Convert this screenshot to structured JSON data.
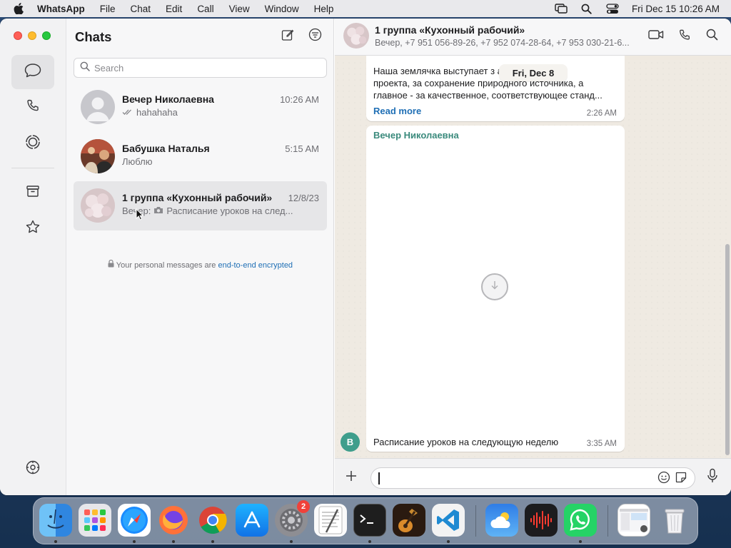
{
  "menubar": {
    "app_name": "WhatsApp",
    "items": [
      "File",
      "Chat",
      "Edit",
      "Call",
      "View",
      "Window",
      "Help"
    ],
    "clock": "Fri Dec 15  10:26 AM"
  },
  "sidebar": {
    "icons": [
      "chats-icon",
      "calls-icon",
      "status-icon",
      "archive-icon",
      "starred-icon",
      "settings-icon"
    ]
  },
  "chatlist": {
    "title": "Chats",
    "search_placeholder": "Search",
    "chats": [
      {
        "name": "Вечер Николаевна",
        "time": "10:26 AM",
        "preview": "hahahaha"
      },
      {
        "name": "Бабушка Наталья",
        "time": "5:15 AM",
        "preview": "Люблю"
      },
      {
        "name": "1 группа «Кухонный рабочий»",
        "time": "12/8/23",
        "preview_sender": "Вечер:",
        "preview": "Расписание уроков на след..."
      }
    ],
    "encrypted_prefix": "Your personal messages are",
    "encrypted_link": "end-to-end encrypted"
  },
  "conversation": {
    "title": "1 группа «Кухонный рабочий»",
    "subtitle": "Вечер, +7 951 056-89-26, +7 952 074-28-64, +7 953 030-21-6...",
    "date_pill": "Fri, Dec 8",
    "message1": {
      "lines": [
        "Наша землячка выступает з                    ание",
        "проекта, за сохранение природного источника, а",
        "главное - за качественное, соответствующее станд..."
      ],
      "read_more": "Read more",
      "time": "2:26 AM"
    },
    "message2": {
      "sender": "Вечер Николаевна",
      "sender_initial": "В",
      "caption": "Расписание уроков на следующую неделю",
      "time": "3:35 AM"
    }
  },
  "dock": {
    "apps": [
      "Finder",
      "Launchpad",
      "Safari",
      "Firefox",
      "Chrome",
      "App Store",
      "System Settings",
      "TextEdit",
      "Terminal",
      "GarageBand",
      "Visual Studio Code",
      "Weather",
      "Voice Memos",
      "WhatsApp",
      "Preview",
      "Trash"
    ],
    "settings_badge": "2"
  },
  "colors": {
    "accent_link": "#1f6fb5",
    "sender_name": "#3a8a7c",
    "whatsapp_green": "#25d366"
  }
}
